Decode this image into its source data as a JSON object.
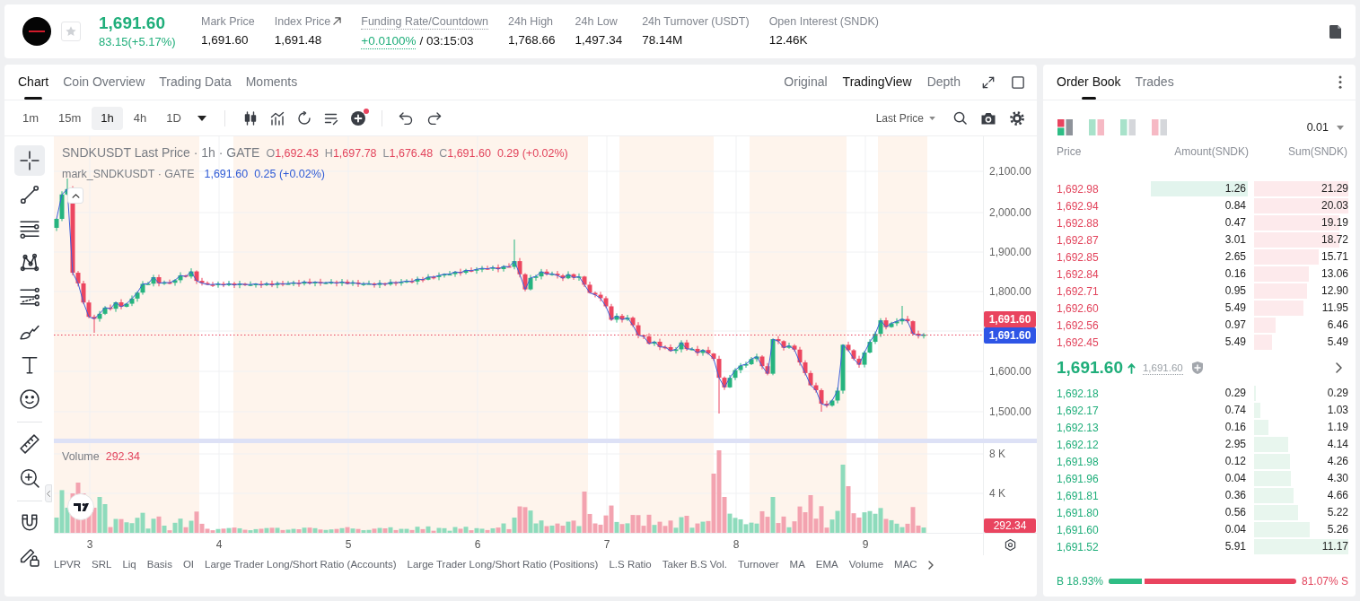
{
  "header": {
    "price": "1,691.60",
    "change": "83.15(+5.17%)",
    "favorite": false,
    "stats": [
      {
        "kind": "plain",
        "label": "Mark Price",
        "value": "1,691.60"
      },
      {
        "kind": "link",
        "label": "Index Price",
        "value": "1,691.48"
      },
      {
        "kind": "funding",
        "label": "Funding Rate/Countdown",
        "rate": "+0.0100%",
        "countdown": "/ 03:15:03"
      },
      {
        "kind": "plain",
        "label": "24h High",
        "value": "1,768.66"
      },
      {
        "kind": "plain",
        "label": "24h Low",
        "value": "1,497.34"
      },
      {
        "kind": "plain",
        "label": "24h Turnover (USDT)",
        "value": "78.14M"
      },
      {
        "kind": "plain",
        "label": "Open Interest (SNDK)",
        "value": "12.46K"
      }
    ]
  },
  "chart_panel": {
    "tabs": [
      {
        "label": "Chart",
        "selected": true
      },
      {
        "label": "Coin Overview",
        "selected": false
      },
      {
        "label": "Trading Data",
        "selected": false
      },
      {
        "label": "Moments",
        "selected": false
      }
    ],
    "view_modes": [
      {
        "label": "Original",
        "selected": false
      },
      {
        "label": "TradingView",
        "selected": true
      },
      {
        "label": "Depth",
        "selected": false
      }
    ],
    "intervals": [
      {
        "label": "1m",
        "selected": false
      },
      {
        "label": "15m",
        "selected": false
      },
      {
        "label": "1h",
        "selected": true
      },
      {
        "label": "4h",
        "selected": false
      },
      {
        "label": "1D",
        "selected": false
      }
    ],
    "price_source": "Last Price",
    "tool_groups": [
      {
        "tools": [
          {
            "kind": "crosshair",
            "selected": true
          },
          {
            "kind": "trend_line",
            "selected": false
          },
          {
            "kind": "parallel_lines",
            "selected": false
          },
          {
            "kind": "pattern",
            "selected": false
          },
          {
            "kind": "fibonacci",
            "selected": false
          },
          {
            "kind": "brush",
            "selected": false
          },
          {
            "kind": "text",
            "selected": false
          },
          {
            "kind": "emoji",
            "selected": false
          }
        ]
      },
      {
        "tools": [
          {
            "kind": "ruler",
            "selected": false
          },
          {
            "kind": "zoom_in",
            "selected": false
          }
        ]
      },
      {
        "tools": [
          {
            "kind": "magnet",
            "selected": false
          },
          {
            "kind": "pencil_lock",
            "selected": false
          }
        ]
      }
    ],
    "legend": {
      "title": "SNDKUSDT Last Price · 1h · GATE",
      "ohlc": [
        {
          "key": "O",
          "value": "1,692.43"
        },
        {
          "key": "H",
          "value": "1,697.78"
        },
        {
          "key": "L",
          "value": "1,676.48"
        },
        {
          "key": "C",
          "value": "1,691.60"
        }
      ],
      "change": "0.29 (+0.02%)"
    },
    "mark_legend": {
      "title": "mark_SNDKUSDT · GATE",
      "value": "1,691.60",
      "change": "0.25 (+0.02%)"
    },
    "price_axis": [
      "2,100.00",
      "2,000.00",
      "1,900.00",
      "1,800.00",
      "1,600.00",
      "1,500.00"
    ],
    "last_price_tag": "1,691.60",
    "mark_price_tag": "1,691.60",
    "volume": {
      "title": "Volume",
      "value": "292.34",
      "axis": [
        "8 K",
        "4 K"
      ],
      "tag": "292.34"
    },
    "time_axis": [
      "3",
      "4",
      "5",
      "6",
      "7",
      "8",
      "9"
    ],
    "indicators": [
      "LPVR",
      "SRL",
      "Liq",
      "Basis",
      "OI",
      "Large Trader Long/Short Ratio (Accounts)",
      "Large Trader Long/Short Ratio (Positions)",
      "L.S Ratio",
      "Taker B.S Vol.",
      "Turnover",
      "MA",
      "EMA",
      "Volume",
      "MAC"
    ]
  },
  "order_book": {
    "tabs": [
      {
        "label": "Order Book",
        "selected": true
      },
      {
        "label": "Trades",
        "selected": false
      }
    ],
    "layouts": [
      {
        "kind": "both",
        "selected": true
      },
      {
        "kind": "both_split",
        "selected": false
      },
      {
        "kind": "bids",
        "selected": false
      },
      {
        "kind": "asks",
        "selected": false
      }
    ],
    "precision": "0.01",
    "columns": [
      "Price",
      "Amount(SNDK)",
      "Sum(SNDK)"
    ],
    "asks": [
      {
        "price": "1,692.98",
        "amount": "1.26",
        "sum": "21.29",
        "level": 1,
        "flash": true
      },
      {
        "price": "1,692.94",
        "amount": "0.84",
        "sum": "20.03",
        "level": 1,
        "flash": false
      },
      {
        "price": "1,692.88",
        "amount": "0.47",
        "sum": "19.19",
        "level": 0.9,
        "flash": false
      },
      {
        "price": "1,692.87",
        "amount": "3.01",
        "sum": "18.72",
        "level": 0.9,
        "flash": false
      },
      {
        "price": "1,692.85",
        "amount": "2.65",
        "sum": "15.71",
        "level": 0.69,
        "flash": false
      },
      {
        "price": "1,692.84",
        "amount": "0.16",
        "sum": "13.06",
        "level": 0.58,
        "flash": false
      },
      {
        "price": "1,692.71",
        "amount": "0.95",
        "sum": "12.90",
        "level": 0.56,
        "flash": false
      },
      {
        "price": "1,692.60",
        "amount": "5.49",
        "sum": "11.95",
        "level": 0.52,
        "flash": false
      },
      {
        "price": "1,692.56",
        "amount": "0.97",
        "sum": "6.46",
        "level": 0.23,
        "flash": false
      },
      {
        "price": "1,692.45",
        "amount": "5.49",
        "sum": "5.49",
        "level": 0.19,
        "flash": false
      }
    ],
    "last_price": "1,691.60",
    "mark_price": "1,691.60",
    "bids": [
      {
        "price": "1,692.18",
        "amount": "0.29",
        "sum": "0.29",
        "level": 0.02,
        "flash": false
      },
      {
        "price": "1,692.17",
        "amount": "0.74",
        "sum": "1.03",
        "level": 0.07,
        "flash": false
      },
      {
        "price": "1,692.13",
        "amount": "0.16",
        "sum": "1.19",
        "level": 0.15,
        "flash": false
      },
      {
        "price": "1,692.12",
        "amount": "2.95",
        "sum": "4.14",
        "level": 0.36,
        "flash": false
      },
      {
        "price": "1,691.98",
        "amount": "0.12",
        "sum": "4.26",
        "level": 0.38,
        "flash": false
      },
      {
        "price": "1,691.96",
        "amount": "0.04",
        "sum": "4.30",
        "level": 0.39,
        "flash": false
      },
      {
        "price": "1,691.81",
        "amount": "0.36",
        "sum": "4.66",
        "level": 0.42,
        "flash": false
      },
      {
        "price": "1,691.80",
        "amount": "0.56",
        "sum": "5.22",
        "level": 0.47,
        "flash": false
      },
      {
        "price": "1,691.60",
        "amount": "0.04",
        "sum": "5.26",
        "level": 0.59,
        "flash": false
      },
      {
        "price": "1,691.52",
        "amount": "5.91",
        "sum": "11.17",
        "level": 1,
        "flash": false
      }
    ],
    "ratio": {
      "buy": "B 18.93%",
      "sell": "81.07% S",
      "level": 0.1893
    }
  }
}
